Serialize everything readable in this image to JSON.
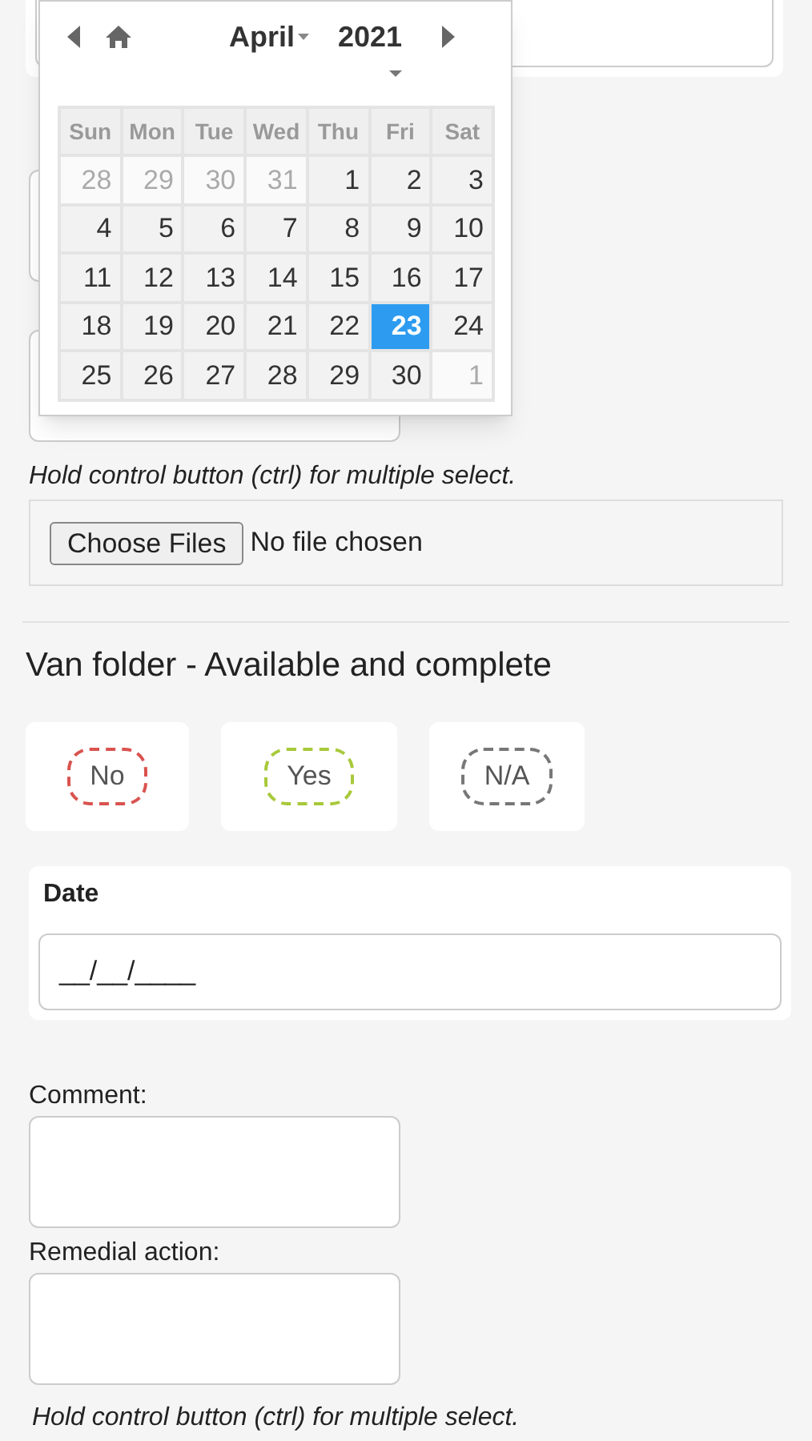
{
  "datepicker": {
    "month": "April",
    "year": "2021",
    "weekdays": [
      "Sun",
      "Mon",
      "Tue",
      "Wed",
      "Thu",
      "Fri",
      "Sat"
    ],
    "days": [
      {
        "label": "28",
        "outside": true,
        "selected": false
      },
      {
        "label": "29",
        "outside": true,
        "selected": false
      },
      {
        "label": "30",
        "outside": true,
        "selected": false
      },
      {
        "label": "31",
        "outside": true,
        "selected": false
      },
      {
        "label": "1",
        "outside": false,
        "selected": false
      },
      {
        "label": "2",
        "outside": false,
        "selected": false
      },
      {
        "label": "3",
        "outside": false,
        "selected": false
      },
      {
        "label": "4",
        "outside": false,
        "selected": false
      },
      {
        "label": "5",
        "outside": false,
        "selected": false
      },
      {
        "label": "6",
        "outside": false,
        "selected": false
      },
      {
        "label": "7",
        "outside": false,
        "selected": false
      },
      {
        "label": "8",
        "outside": false,
        "selected": false
      },
      {
        "label": "9",
        "outside": false,
        "selected": false
      },
      {
        "label": "10",
        "outside": false,
        "selected": false
      },
      {
        "label": "11",
        "outside": false,
        "selected": false
      },
      {
        "label": "12",
        "outside": false,
        "selected": false
      },
      {
        "label": "13",
        "outside": false,
        "selected": false
      },
      {
        "label": "14",
        "outside": false,
        "selected": false
      },
      {
        "label": "15",
        "outside": false,
        "selected": false
      },
      {
        "label": "16",
        "outside": false,
        "selected": false
      },
      {
        "label": "17",
        "outside": false,
        "selected": false
      },
      {
        "label": "18",
        "outside": false,
        "selected": false
      },
      {
        "label": "19",
        "outside": false,
        "selected": false
      },
      {
        "label": "20",
        "outside": false,
        "selected": false
      },
      {
        "label": "21",
        "outside": false,
        "selected": false
      },
      {
        "label": "22",
        "outside": false,
        "selected": false
      },
      {
        "label": "23",
        "outside": false,
        "selected": true
      },
      {
        "label": "24",
        "outside": false,
        "selected": false
      },
      {
        "label": "25",
        "outside": false,
        "selected": false
      },
      {
        "label": "26",
        "outside": false,
        "selected": false
      },
      {
        "label": "27",
        "outside": false,
        "selected": false
      },
      {
        "label": "28",
        "outside": false,
        "selected": false
      },
      {
        "label": "29",
        "outside": false,
        "selected": false
      },
      {
        "label": "30",
        "outside": false,
        "selected": false
      },
      {
        "label": "1",
        "outside": true,
        "selected": false
      }
    ]
  },
  "hint_1": "Hold control button (ctrl) for multiple select.",
  "file_input": {
    "button": "Choose Files",
    "status": "No file chosen"
  },
  "section": {
    "title": "Van folder - Available and complete",
    "options": [
      {
        "label": "No",
        "color": "#d9534f"
      },
      {
        "label": "Yes",
        "color": "#a8c93a"
      },
      {
        "label": "N/A",
        "color": "#777777"
      }
    ],
    "date": {
      "label": "Date",
      "value": "__/__/____"
    },
    "comment": {
      "label": "Comment:"
    },
    "remedial": {
      "label": "Remedial action:"
    },
    "hint": "Hold control button (ctrl) for multiple select."
  }
}
